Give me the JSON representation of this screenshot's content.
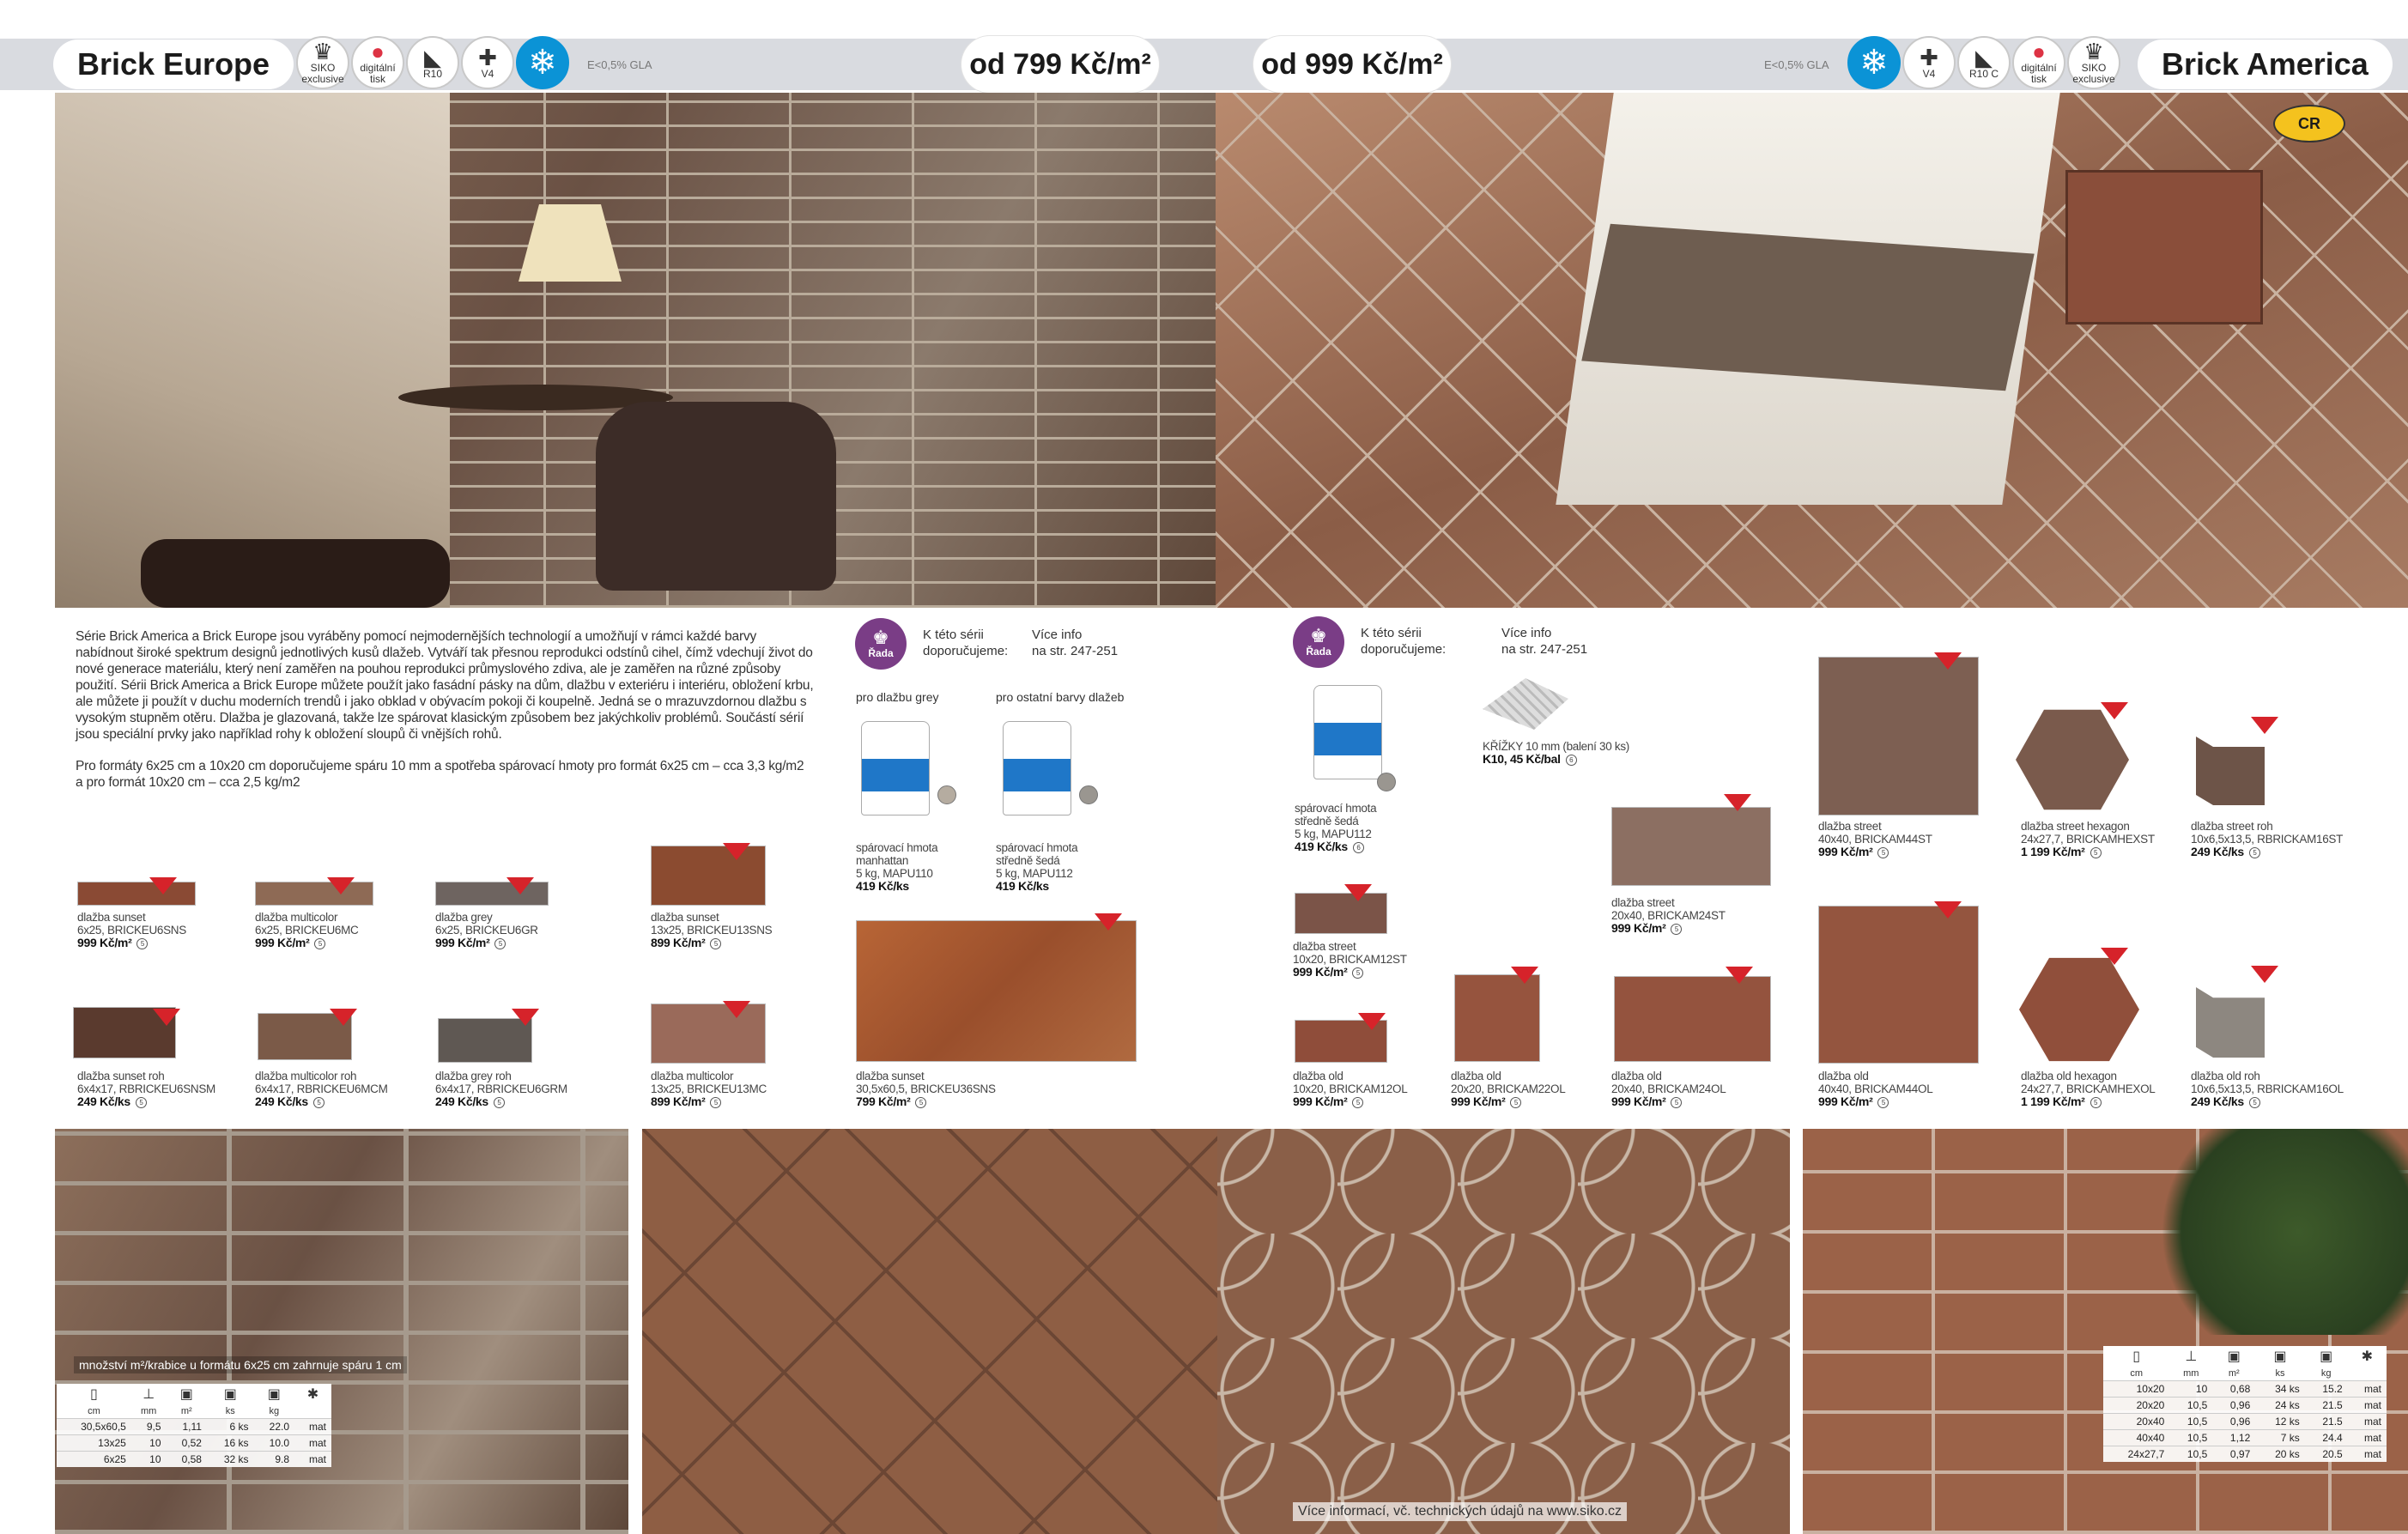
{
  "left": {
    "title": "Brick Europe",
    "price": "od 799 Kč/m²",
    "note": "E<0,5% GLA",
    "badges": [
      {
        "icon": "siko-icon",
        "label": "SIKO exclusive"
      },
      {
        "icon": "digital-print-icon",
        "label": "digitální tisk"
      },
      {
        "icon": "slip-icon",
        "label": "R10"
      },
      {
        "icon": "variation-icon",
        "label": "V4"
      },
      {
        "icon": "frost-icon",
        "label": ""
      }
    ],
    "intro": [
      "Série Brick America a Brick Europe jsou vyráběny pomocí nejmodernějších technologií a umožňují v rámci každé barvy nabídnout široké spektrum designů jednotlivých kusů dlažeb. Vytváří tak přesnou reprodukci odstínů cihel, čímž vdechují život do nové generace materiálu, který není zaměřen na pouhou reprodukci průmyslového zdiva, ale je zaměřen na různé způsoby použití. Sérii Brick America a Brick Europe můžete použít jako fasádní pásky na dům, dlažbu v exteriéru i interiéru, obložení krbu, ale můžete ji použít v duchu moderních trendů i jako obklad v obývacím pokoji či koupelně. Jedná se o mrazuvzdornou dlažbu s vysokým stupněm otěru. Dlažba je glazovaná, takže lze spárovat klasickým způsobem bez jakýchkoliv problémů. Součástí sérií jsou speciální prvky jako například rohy k obložení sloupů či vnějších rohů.",
      "Pro formáty 6x25 cm a 10x20 cm doporučujeme spáru 10 mm a spotřeba spárovací hmoty pro formát 6x25 cm – cca 3,3 kg/m2 a pro formát 10x20 cm – cca 2,5 kg/m2"
    ],
    "rec": {
      "badge": "Řada",
      "line1": "K této sérii",
      "line2": "doporučujeme:",
      "more1": "Více info",
      "more2": "na str. 247-251",
      "col1": "pro dlažbu grey",
      "col2": "pro ostatní barvy dlažeb"
    },
    "grouts": [
      {
        "name": "spárovací hmota",
        "color": "manhattan",
        "pack": "5 kg, MAPU110",
        "price": "419 Kč/ks"
      },
      {
        "name": "spárovací hmota",
        "color": "středně šedá",
        "pack": "5 kg, MAPU112",
        "price": "419 Kč/ks"
      }
    ],
    "tiles": [
      {
        "name": "dlažba sunset",
        "code": "6x25, BRICKEU6SNS",
        "price": "999 Kč/m²",
        "tag": "5",
        "c": "#8a4a34"
      },
      {
        "name": "dlažba multicolor",
        "code": "6x25, BRICKEU6MC",
        "price": "999 Kč/m²",
        "tag": "5",
        "c": "#8e6a55"
      },
      {
        "name": "dlažba grey",
        "code": "6x25, BRICKEU6GR",
        "price": "999 Kč/m²",
        "tag": "5",
        "c": "#6e6460"
      },
      {
        "name": "dlažba sunset",
        "code": "13x25, BRICKEU13SNS",
        "price": "899 Kč/m²",
        "tag": "5",
        "c": "#8b4b30"
      },
      {
        "name": "dlažba sunset roh",
        "code": "6x4x17, RBRICKEU6SNSM",
        "price": "249 Kč/ks",
        "tag": "5",
        "c": "#5a3a2e"
      },
      {
        "name": "dlažba multicolor roh",
        "code": "6x4x17, RBRICKEU6MCM",
        "price": "249 Kč/ks",
        "tag": "5",
        "c": "#7b5a48"
      },
      {
        "name": "dlažba grey roh",
        "code": "6x4x17, RBRICKEU6GRM",
        "price": "249 Kč/ks",
        "tag": "5",
        "c": "#5f5853"
      },
      {
        "name": "dlažba multicolor",
        "code": "13x25, BRICKEU13MC",
        "price": "899 Kč/m²",
        "tag": "5",
        "c": "#9a6a5a"
      },
      {
        "name": "dlažba sunset",
        "code": "30,5x60,5, BRICKEU36SNS",
        "price": "799 Kč/m²",
        "tag": "5",
        "c": "#a55a32"
      }
    ],
    "boxnote": "množství m²/krabice u formátu 6x25 cm zahrnuje spáru 1 cm",
    "table": {
      "headers": [
        "cm",
        "mm",
        "m²",
        "ks",
        "kg",
        ""
      ],
      "icons": [
        "▯",
        "⊥",
        "▣",
        "▣",
        "▣",
        "✱"
      ],
      "rows": [
        [
          "30,5x60,5",
          "9,5",
          "1,11",
          "6 ks",
          "22.0",
          "mat"
        ],
        [
          "13x25",
          "10",
          "0,52",
          "16 ks",
          "10.0",
          "mat"
        ],
        [
          "6x25",
          "10",
          "0,58",
          "32 ks",
          "9.8",
          "mat"
        ]
      ]
    }
  },
  "right": {
    "title": "Brick America",
    "price": "od 999 Kč/m²",
    "note": "E<0,5% GLA",
    "logo": "CR",
    "badges": [
      {
        "icon": "frost-icon",
        "label": ""
      },
      {
        "icon": "variation-icon",
        "label": "V4"
      },
      {
        "icon": "slip-icon",
        "label": "R10 C"
      },
      {
        "icon": "digital-print-icon",
        "label": "digitální tisk"
      },
      {
        "icon": "siko-icon",
        "label": "SIKO exclusive"
      }
    ],
    "rec": {
      "badge": "Řada",
      "line1": "K této sérii",
      "line2": "doporučujeme:",
      "more1": "Více info",
      "more2": "na str. 247-251"
    },
    "grout": {
      "name": "spárovací hmota",
      "color": "středně šedá",
      "pack": "5 kg, MAPU112",
      "price": "419 Kč/ks"
    },
    "cross": {
      "name": "KŘÍŽKY 10 mm (balení 30 ks)",
      "price": "K10, 45 Kč/bal"
    },
    "tiles": [
      {
        "name": "dlažba street",
        "code": "10x20, BRICKAM12ST",
        "price": "999 Kč/m²",
        "tag": "4",
        "c": "#7b5448"
      },
      {
        "name": "dlažba street",
        "code": "20x40, BRICKAM24ST",
        "price": "999 Kč/m²",
        "tag": "4",
        "c": "#8c6f62"
      },
      {
        "name": "dlažba street",
        "code": "40x40, BRICKAM44ST",
        "price": "999 Kč/m²",
        "tag": "4",
        "c": "#7d5f52"
      },
      {
        "name": "dlažba street hexagon",
        "code": "24x27,7, BRICKAMHEXST",
        "price": "1 199 Kč/m²",
        "tag": "4",
        "c": "#7a5a4c"
      },
      {
        "name": "dlažba street roh",
        "code": "10x6,5x13,5, RBRICKAM16ST",
        "price": "249 Kč/ks",
        "tag": "4",
        "c": "#6d5448"
      },
      {
        "name": "dlažba old",
        "code": "10x20, BRICKAM12OL",
        "price": "999 Kč/m²",
        "tag": "4",
        "c": "#8f4d3a"
      },
      {
        "name": "dlažba old",
        "code": "20x20, BRICKAM22OL",
        "price": "999 Kč/m²",
        "tag": "4",
        "c": "#96543e"
      },
      {
        "name": "dlažba old",
        "code": "20x40, BRICKAM24OL",
        "price": "999 Kč/m²",
        "tag": "4",
        "c": "#94533e"
      },
      {
        "name": "dlažba old",
        "code": "40x40, BRICKAM44OL",
        "price": "999 Kč/m²",
        "tag": "4",
        "c": "#94553f"
      },
      {
        "name": "dlažba old hexagon",
        "code": "24x27,7, BRICKAMHEXOL",
        "price": "1 199 Kč/m²",
        "tag": "4",
        "c": "#904f3b"
      },
      {
        "name": "dlažba old roh",
        "code": "10x6,5x13,5, RBRICKAM16OL",
        "price": "249 Kč/ks",
        "tag": "4",
        "c": "#8d8780"
      }
    ],
    "table": {
      "headers": [
        "cm",
        "mm",
        "m²",
        "ks",
        "kg",
        ""
      ],
      "icons": [
        "▯",
        "⊥",
        "▣",
        "▣",
        "▣",
        "✱"
      ],
      "rows": [
        [
          "10x20",
          "10",
          "0,68",
          "34 ks",
          "15.2",
          "mat"
        ],
        [
          "20x20",
          "10,5",
          "0,96",
          "24 ks",
          "21.5",
          "mat"
        ],
        [
          "20x40",
          "10,5",
          "0,96",
          "12 ks",
          "21.5",
          "mat"
        ],
        [
          "40x40",
          "10,5",
          "1,12",
          "7 ks",
          "24.4",
          "mat"
        ],
        [
          "24x27,7",
          "10,5",
          "0,97",
          "20 ks",
          "20.5",
          "mat"
        ]
      ]
    }
  },
  "footer": "Více informací, vč. technických údajů na www.siko.cz"
}
